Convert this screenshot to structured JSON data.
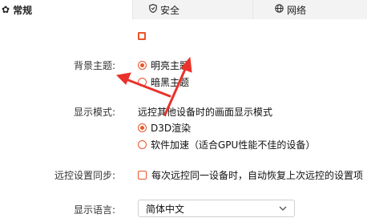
{
  "tabs": [
    {
      "label": "常规",
      "icon": "gear-icon",
      "active": true
    },
    {
      "label": "安全",
      "icon": "shield-icon",
      "active": false
    },
    {
      "label": "网络",
      "icon": "globe-icon",
      "active": false
    }
  ],
  "settings": {
    "background_theme": {
      "label": "背景主题:",
      "options": [
        {
          "label": "明亮主题",
          "selected": true
        },
        {
          "label": "暗黑主题",
          "selected": false
        }
      ]
    },
    "display_mode": {
      "label": "显示模式:",
      "description": "远控其他设备时的画面显示模式",
      "options": [
        {
          "label": "D3D渲染",
          "selected": true
        },
        {
          "label": "软件加速（适合GPU性能不佳的设备）",
          "selected": false
        }
      ]
    },
    "remote_sync": {
      "label": "远控设置同步:",
      "checkbox_label": "每次远控同一设备时，自动恢复上次远控的设置项",
      "checked": false
    },
    "display_language": {
      "label": "显示语言:",
      "selected": "简体中文"
    }
  },
  "colors": {
    "accent": "#e8552b",
    "annotation_arrow": "#e8322b"
  }
}
